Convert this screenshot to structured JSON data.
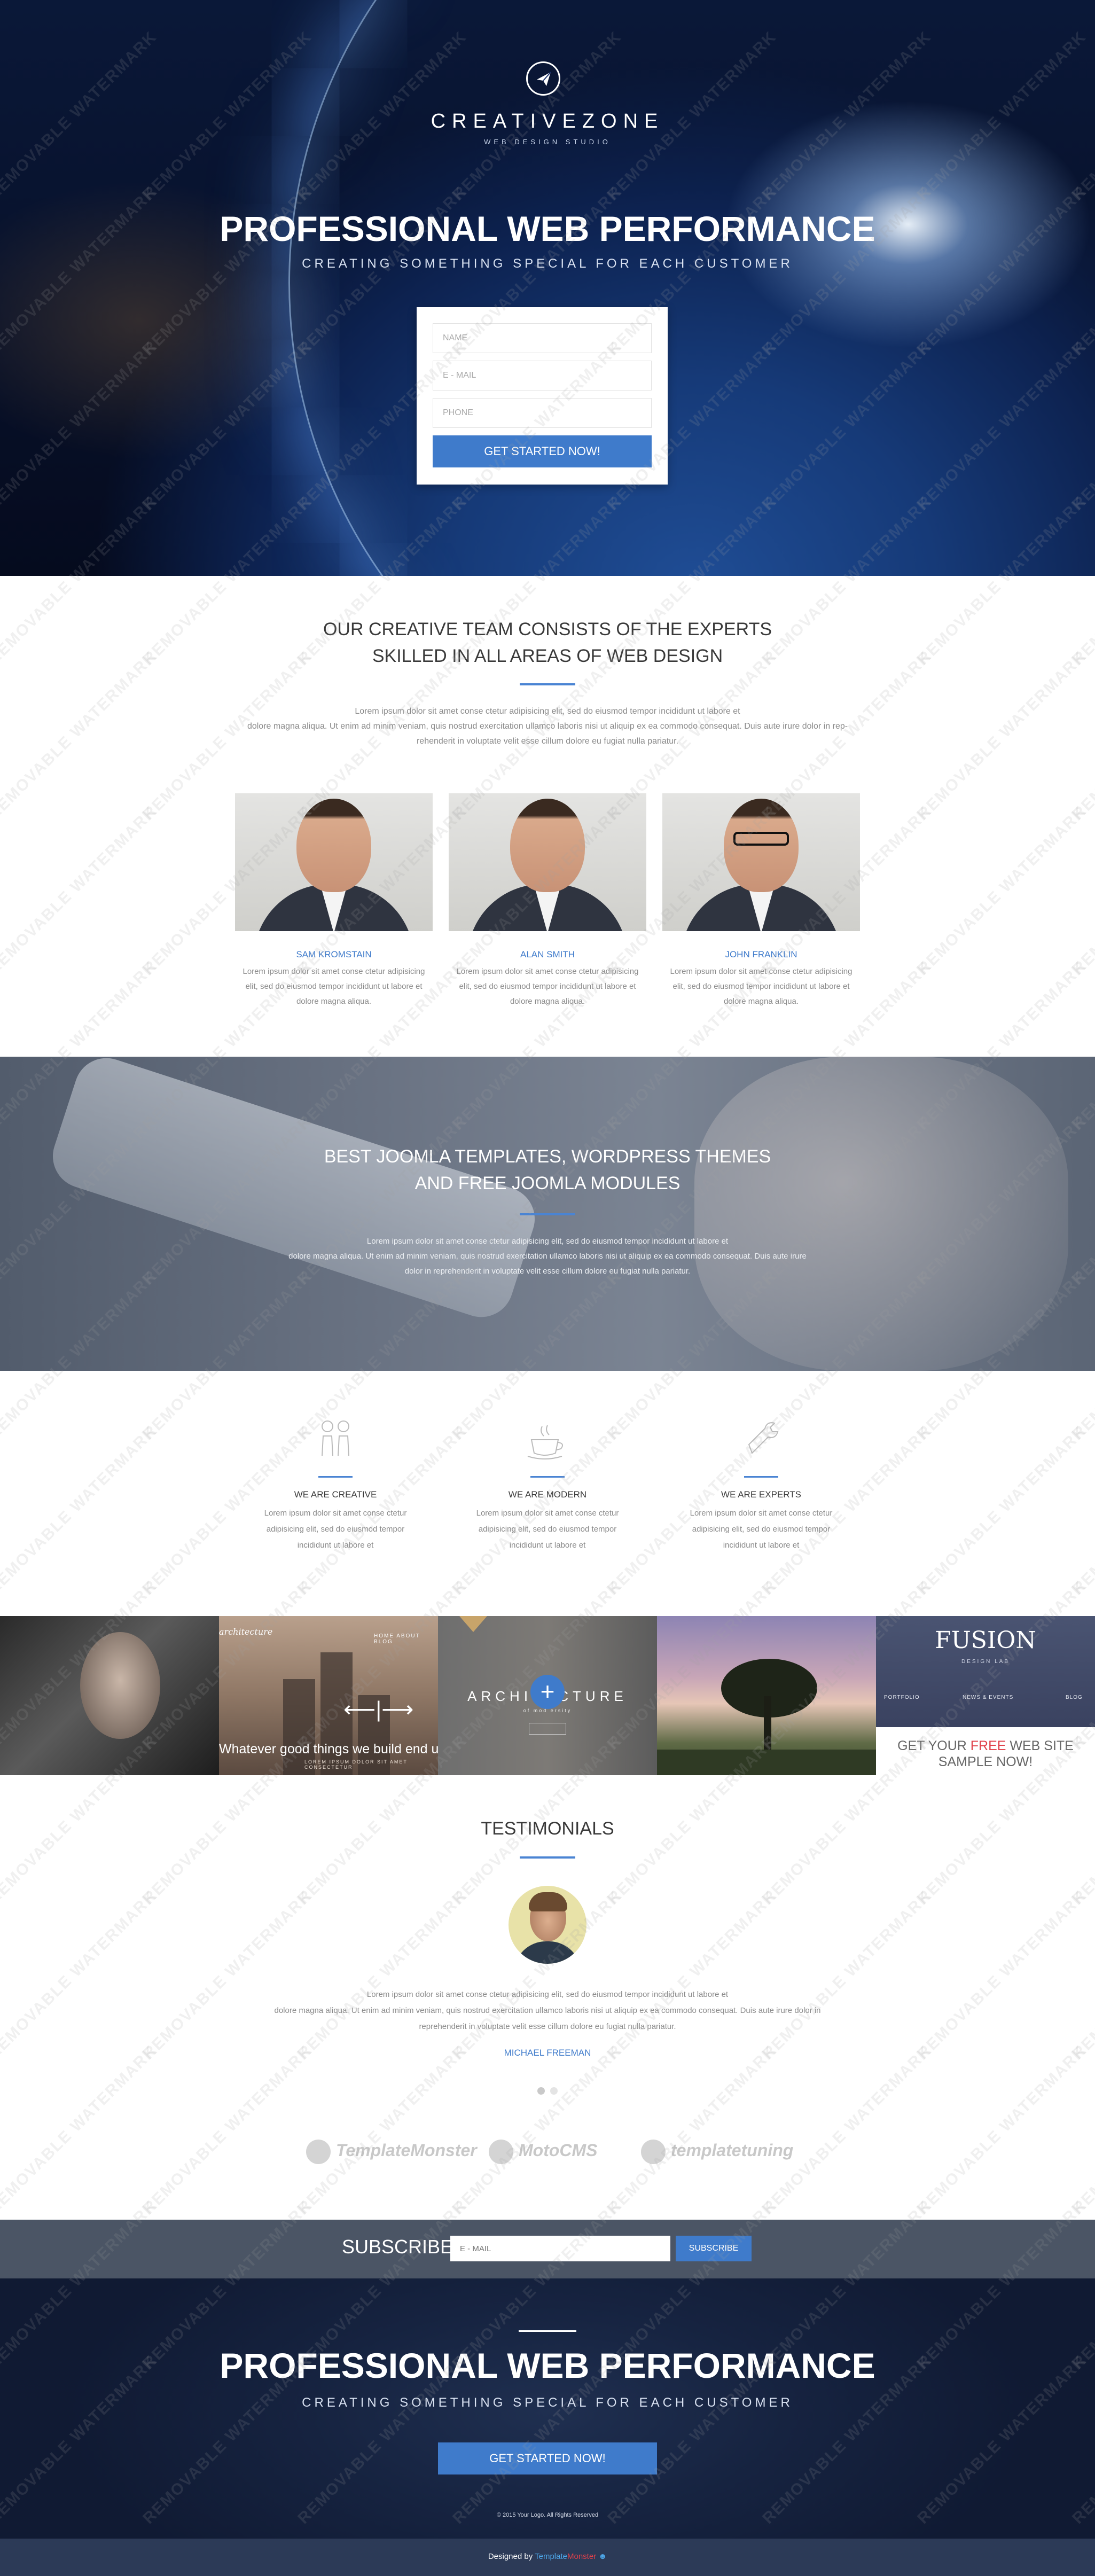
{
  "hero": {
    "brand": "CREATIVEZONE",
    "brand_sub": "WEB DESIGN STUDIO",
    "title": "PROFESSIONAL WEB PERFORMANCE",
    "subtitle": "CREATING SOMETHING SPECIAL FOR EACH CUSTOMER",
    "form": {
      "name_placeholder": "NAME",
      "email_placeholder": "E - MAIL",
      "phone_placeholder": "PHONE",
      "button": "GET STARTED NOW!"
    }
  },
  "team": {
    "title_line1": "OUR CREATIVE TEAM CONSISTS OF THE EXPERTS",
    "title_line2": "SKILLED IN ALL AREAS OF WEB DESIGN",
    "intro_line1": "Lorem ipsum dolor sit amet conse ctetur adipisicing elit, sed do eiusmod tempor incididunt ut labore et",
    "intro_line2": "dolore magna aliqua. Ut enim ad minim veniam, quis nostrud exercitation ullamco laboris nisi ut aliquip ex ea commodo consequat. Duis aute irure dolor in rep-",
    "intro_line3": "rehenderit in voluptate velit esse cillum dolore eu fugiat nulla pariatur.",
    "members": [
      {
        "name": "SAM KROMSTAIN",
        "text1": "Lorem ipsum dolor sit amet conse ctetur adipisicing",
        "text2": "elit, sed do eiusmod tempor incididunt ut labore et",
        "text3": "dolore magna aliqua."
      },
      {
        "name": "ALAN SMITH",
        "text1": "Lorem ipsum dolor sit amet conse ctetur adipisicing",
        "text2": "elit, sed do eiusmod tempor incididunt ut labore et",
        "text3": "dolore magna aliqua."
      },
      {
        "name": "JOHN FRANKLIN",
        "text1": "Lorem ipsum dolor sit amet conse ctetur adipisicing",
        "text2": "elit, sed do eiusmod tempor incididunt ut labore et",
        "text3": "dolore magna aliqua."
      }
    ]
  },
  "band": {
    "title_line1": "BEST JOOMLA TEMPLATES, WORDPRESS THEMES",
    "title_line2": "AND FREE JOOMLA MODULES",
    "text_line1": "Lorem ipsum dolor sit amet conse ctetur adipisicing elit, sed do eiusmod tempor incididunt ut labore et",
    "text_line2": "dolore magna aliqua. Ut enim ad minim veniam, quis nostrud exercitation ullamco laboris nisi ut aliquip ex ea commodo consequat. Duis aute irure",
    "text_line3": "dolor in reprehenderit in voluptate velit esse cillum dolore eu fugiat nulla pariatur."
  },
  "features": [
    {
      "icon": "people-icon",
      "title": "WE ARE CREATIVE",
      "text1": "Lorem ipsum dolor sit amet conse ctetur",
      "text2": "adipisicing elit, sed do eiusmod tempor",
      "text3": "incididunt ut labore et"
    },
    {
      "icon": "coffee-cup-icon",
      "title": "WE ARE MODERN",
      "text1": "Lorem ipsum dolor sit amet conse ctetur",
      "text2": "adipisicing elit, sed do eiusmod tempor",
      "text3": "incididunt ut labore et"
    },
    {
      "icon": "wrench-icon",
      "title": "WE ARE EXPERTS",
      "text1": "Lorem ipsum dolor sit amet conse ctetur",
      "text2": "adipisicing elit, sed do eiusmod tempor",
      "text3": "incididunt ut labore et"
    }
  ],
  "portfolio": {
    "tile2_logo": "architecture",
    "tile2_nav": "HOME   ABOUT   BLOG",
    "tile2_text": "Whatever good things we build end u",
    "tile2_sub": "LOREM IPSUM DOLOR SIT AMET CONSECTETUR",
    "tile3_title": "ARCHITECTURE",
    "tile3_sub": "of mod  ersity",
    "tile5_logo": "FUSION",
    "tile5_lab": "DESIGN LAB",
    "tile5_nav": [
      "PORTFOLIO",
      "NEWS & EVENTS",
      "BLOG"
    ],
    "tile5_cta_pre": "GET YOUR ",
    "tile5_cta_free": "FREE",
    "tile5_cta_post": " WEB SITE",
    "tile5_cta_line2": "SAMPLE NOW!"
  },
  "testimonials": {
    "title": "TESTIMONIALS",
    "text_line1": "Lorem ipsum dolor sit amet conse ctetur adipisicing elit, sed do eiusmod tempor incididunt ut labore et",
    "text_line2": "dolore magna aliqua. Ut enim ad minim veniam, quis nostrud exercitation ullamco laboris nisi ut aliquip ex ea commodo consequat. Duis aute irure dolor in",
    "text_line3": "reprehenderit in voluptate velit esse cillum dolore eu fugiat nulla pariatur.",
    "name": "MICHAEL FREEMAN",
    "partners": [
      "TemplateMonster",
      "MotoCMS",
      "templatetuning"
    ]
  },
  "subscribe": {
    "label": "SUBSCRIBE",
    "placeholder": "E - MAIL",
    "button": "SUBSCRIBE"
  },
  "footer": {
    "title": "PROFESSIONAL WEB PERFORMANCE",
    "subtitle": "CREATING SOMETHING SPECIAL FOR EACH CUSTOMER",
    "button": "GET STARTED NOW!",
    "copyright": "© 2015 Your Logo. All Rights Reserved",
    "designed_by": "Designed by",
    "tm_part1": "Template",
    "tm_part2": "Monster"
  },
  "watermark": "REMOVABLE WATERMARK",
  "colors": {
    "accent": "#3f7bcb",
    "subscribe_bar": "#4b5565",
    "footer_bar": "#2c3a57",
    "free_highlight": "#e0414a"
  }
}
